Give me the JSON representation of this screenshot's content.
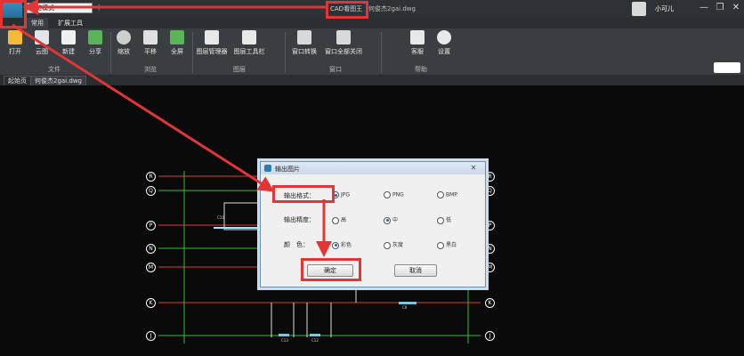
{
  "titlebar": {
    "mode_select": "浏览模式",
    "qa_separator": "|",
    "app_title": "CAD看图王",
    "file_title": "何俊杰2gai.dwg",
    "user_name": "小可儿",
    "min_icon": "—",
    "restore_icon": "❐",
    "close_icon": "✕"
  },
  "menubar": {
    "tabs": [
      {
        "label": "常用",
        "active": true
      },
      {
        "label": "扩展工具",
        "active": false
      }
    ]
  },
  "ribbon": {
    "buttons": [
      {
        "label": "打开",
        "icon": "folder-icon",
        "color": "#f5b93a"
      },
      {
        "label": "云图",
        "icon": "cloud-icon",
        "color": "#dfe5ea"
      },
      {
        "label": "新建",
        "icon": "new-file-icon",
        "color": "#f0f0f0"
      },
      {
        "label": "分享",
        "icon": "share-icon",
        "color": "#5ab45a"
      },
      {
        "label": "缩放",
        "icon": "zoom-icon",
        "color": "#cfcfcf"
      },
      {
        "label": "平移",
        "icon": "hand-icon",
        "color": "#e0e0e0"
      },
      {
        "label": "全屏",
        "icon": "fullscreen-icon",
        "color": "#5ab45a"
      },
      {
        "label": "图层管理器",
        "icon": "layers-icon",
        "color": "#e8e8e8"
      },
      {
        "label": "图层工具栏",
        "icon": "layer-toolbar-icon",
        "color": "#e8e8e8"
      },
      {
        "label": "窗口转换",
        "icon": "window-switch-icon",
        "color": "#d9d9d9"
      },
      {
        "label": "窗口全部关闭",
        "icon": "close-all-windows-icon",
        "color": "#d9d9d9"
      },
      {
        "label": "客服",
        "icon": "customer-service-icon",
        "color": "#e8e8e8"
      },
      {
        "label": "设置",
        "icon": "settings-icon",
        "color": "#e8e8e8"
      }
    ],
    "groups": [
      "文件",
      "浏览",
      "图层",
      "窗口",
      "帮助"
    ]
  },
  "tabs": [
    {
      "label": "起始页"
    },
    {
      "label": "何俊杰2gai.dwg"
    }
  ],
  "drawing": {
    "axes": [
      "R",
      "Q",
      "P",
      "N",
      "M",
      "K",
      "J"
    ],
    "text_labels": [
      "C13",
      "C12",
      "C8",
      "C10"
    ]
  },
  "dialog": {
    "title": "输出图片",
    "close_label": "✕",
    "rows": [
      {
        "label": "输出格式：",
        "options": [
          "JPG",
          "PNG",
          "BMP"
        ],
        "selected": 0
      },
      {
        "label": "输出精度：",
        "options": [
          "高",
          "中",
          "低"
        ],
        "selected": 1
      },
      {
        "label": "颜　色：",
        "options": [
          "彩色",
          "灰度",
          "黑白"
        ],
        "selected": 0
      }
    ],
    "ok_label": "确定",
    "cancel_label": "取消"
  },
  "colors": {
    "annotation_red": "#e23636",
    "axis_green": "#2ec22e"
  }
}
